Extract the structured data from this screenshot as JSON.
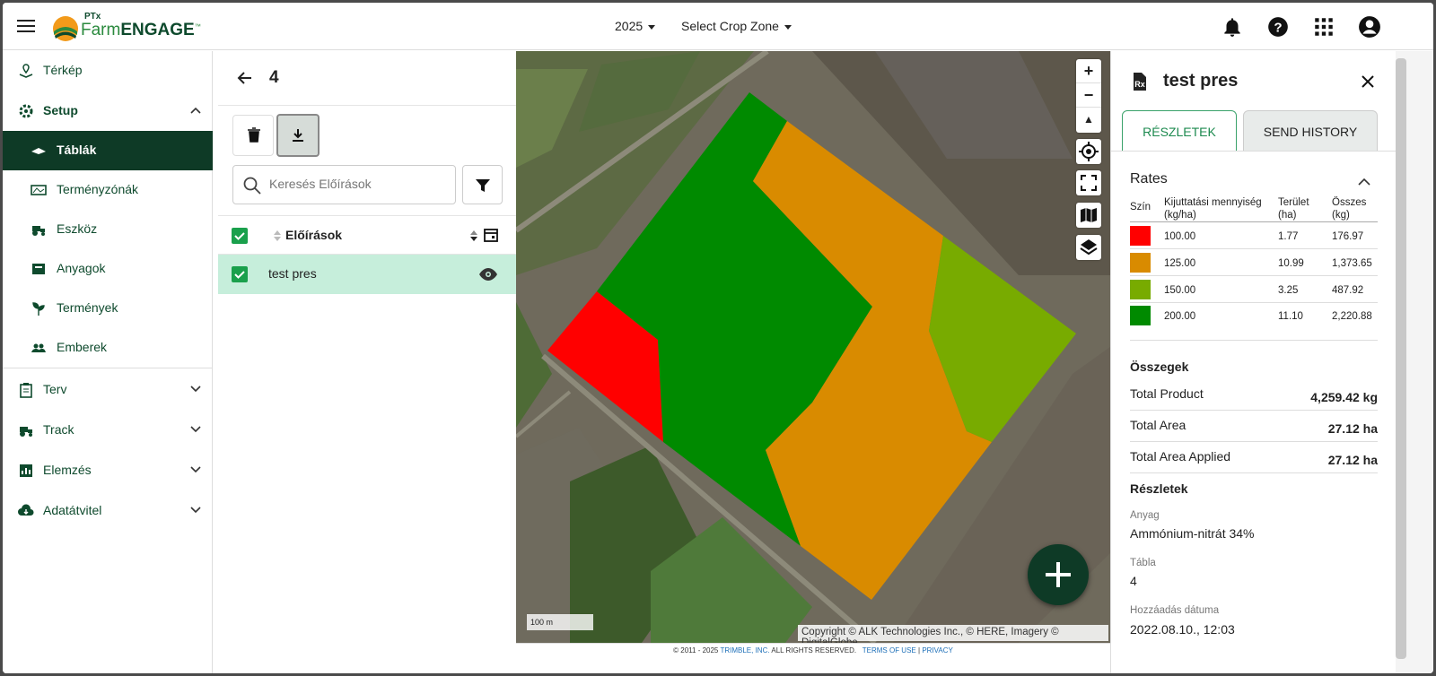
{
  "header": {
    "logo_ptx": "PTx",
    "logo_farm": "Farm",
    "logo_engage": "ENGAGE",
    "logo_tm": "™",
    "year": "2025",
    "crop_zone": "Select Crop Zone"
  },
  "sidebar": {
    "items": [
      {
        "label": "Térkép"
      },
      {
        "label": "Setup"
      },
      {
        "label": "Táblák"
      },
      {
        "label": "Terményzónák"
      },
      {
        "label": "Eszköz"
      },
      {
        "label": "Anyagok"
      },
      {
        "label": "Termények"
      },
      {
        "label": "Emberek"
      },
      {
        "label": "Terv"
      },
      {
        "label": "Track"
      },
      {
        "label": "Elemzés"
      },
      {
        "label": "Adatátvitel"
      }
    ]
  },
  "list": {
    "title": "4",
    "search_placeholder": "Keresés Előírások",
    "column_header": "Előírások",
    "rows": [
      {
        "name": "test pres"
      }
    ]
  },
  "map": {
    "scale": "100 m",
    "copyright": "Copyright © ALK Technologies Inc., © HERE, Imagery © DigitalGlobe",
    "footer_copy": "© 2011 - 2025",
    "footer_trimble": "TRIMBLE, INC.",
    "footer_rights": "ALL RIGHTS RESERVED.",
    "footer_terms": "TERMS OF USE",
    "footer_sep": "|",
    "footer_privacy": "PRIVACY",
    "zone_colors": [
      "#ff0000",
      "#d98b00",
      "#78ab00",
      "#008a00"
    ]
  },
  "details": {
    "title": "test pres",
    "tab_details": "RÉSZLETEK",
    "tab_history": "SEND HISTORY",
    "rates_title": "Rates",
    "col_color": "Szín",
    "col_rate": "Kijuttatási mennyiség (kg/ha)",
    "col_area": "Terület (ha)",
    "col_total": "Összes (kg)",
    "rates": [
      {
        "color": "#ff0000",
        "rate": "100.00",
        "area": "1.77",
        "total": "176.97"
      },
      {
        "color": "#d98b00",
        "rate": "125.00",
        "area": "10.99",
        "total": "1,373.65"
      },
      {
        "color": "#78ab00",
        "rate": "150.00",
        "area": "3.25",
        "total": "487.92"
      },
      {
        "color": "#008a00",
        "rate": "200.00",
        "area": "11.10",
        "total": "2,220.88"
      }
    ],
    "summary_title": "Összegek",
    "summary": [
      {
        "label": "Total Product",
        "value": "4,259.42 kg"
      },
      {
        "label": "Total Area",
        "value": "27.12 ha"
      },
      {
        "label": "Total Area Applied",
        "value": "27.12 ha"
      }
    ],
    "details_title": "Részletek",
    "material_label": "Anyag",
    "material": "Ammónium-nitrát 34%",
    "field_label": "Tábla",
    "field": "4",
    "date_label": "Hozzáadás dátuma",
    "date": "2022.08.10., 12:03"
  }
}
